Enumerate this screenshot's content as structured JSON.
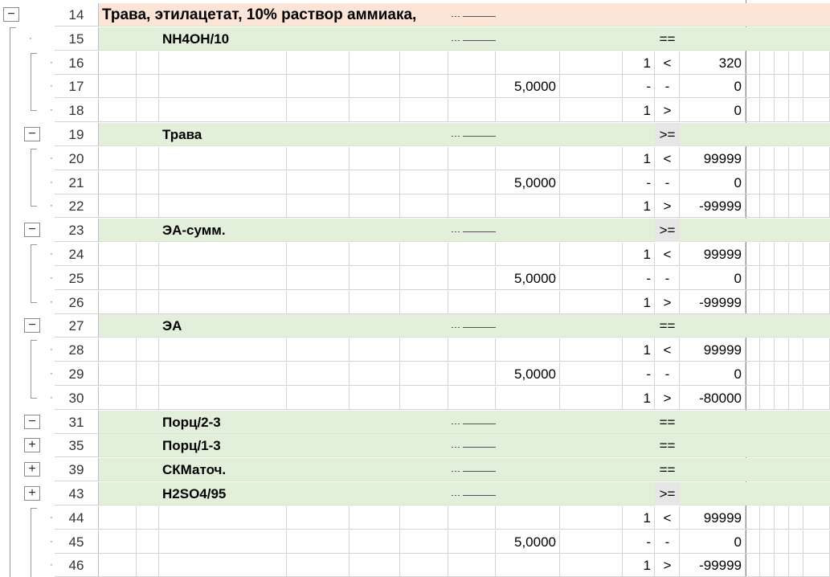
{
  "colors": {
    "header_fill": "#fce4d6",
    "group_fill": "#e2efda",
    "op_fill": "#e7e6e6",
    "grid": "#d4d4d4"
  },
  "rows": [
    {
      "num": "14",
      "kind": "header",
      "title": "Трава, этилацетат,  10% раствор аммиака,",
      "toggle": "−"
    },
    {
      "num": "15",
      "kind": "group",
      "name": "NH4OH/10",
      "op": "==",
      "toggle": ""
    },
    {
      "num": "16",
      "kind": "detail",
      "a": "",
      "c": "1",
      "d": "<",
      "e": "320"
    },
    {
      "num": "17",
      "kind": "detail",
      "a": "5,0000",
      "c": "-",
      "d": "-",
      "e": "0"
    },
    {
      "num": "18",
      "kind": "detail",
      "a": "",
      "c": "1",
      "d": ">",
      "e": "0"
    },
    {
      "num": "19",
      "kind": "group",
      "name": "Трава",
      "op": ">=",
      "toggle": "−"
    },
    {
      "num": "20",
      "kind": "detail",
      "a": "",
      "c": "1",
      "d": "<",
      "e": "99999"
    },
    {
      "num": "21",
      "kind": "detail",
      "a": "5,0000",
      "c": "-",
      "d": "-",
      "e": "0"
    },
    {
      "num": "22",
      "kind": "detail",
      "a": "",
      "c": "1",
      "d": ">",
      "e": "-99999"
    },
    {
      "num": "23",
      "kind": "group",
      "name": "ЭА-сумм.",
      "op": ">=",
      "toggle": "−"
    },
    {
      "num": "24",
      "kind": "detail",
      "a": "",
      "c": "1",
      "d": "<",
      "e": "99999"
    },
    {
      "num": "25",
      "kind": "detail",
      "a": "5,0000",
      "c": "-",
      "d": "-",
      "e": "0"
    },
    {
      "num": "26",
      "kind": "detail",
      "a": "",
      "c": "1",
      "d": ">",
      "e": "-99999"
    },
    {
      "num": "27",
      "kind": "group",
      "name": "ЭА",
      "op": "==",
      "toggle": "−"
    },
    {
      "num": "28",
      "kind": "detail",
      "a": "",
      "c": "1",
      "d": "<",
      "e": "99999"
    },
    {
      "num": "29",
      "kind": "detail",
      "a": "5,0000",
      "c": "-",
      "d": "-",
      "e": "0"
    },
    {
      "num": "30",
      "kind": "detail",
      "a": "",
      "c": "1",
      "d": ">",
      "e": "-80000"
    },
    {
      "num": "31",
      "kind": "group",
      "name": "Порц/2-3",
      "op": "==",
      "toggle": "−"
    },
    {
      "num": "35",
      "kind": "group",
      "name": "Порц/1-3",
      "op": "==",
      "toggle": "+"
    },
    {
      "num": "39",
      "kind": "group",
      "name": "СКМаточ.",
      "op": "==",
      "toggle": "+"
    },
    {
      "num": "43",
      "kind": "group",
      "name": "H2SO4/95",
      "op": ">=",
      "toggle": "+"
    },
    {
      "num": "44",
      "kind": "detail",
      "a": "",
      "c": "1",
      "d": "<",
      "e": "99999"
    },
    {
      "num": "45",
      "kind": "detail",
      "a": "5,0000",
      "c": "-",
      "d": "-",
      "e": "0"
    },
    {
      "num": "46",
      "kind": "detail",
      "a": "",
      "c": "1",
      "d": ">",
      "e": "-99999"
    }
  ]
}
